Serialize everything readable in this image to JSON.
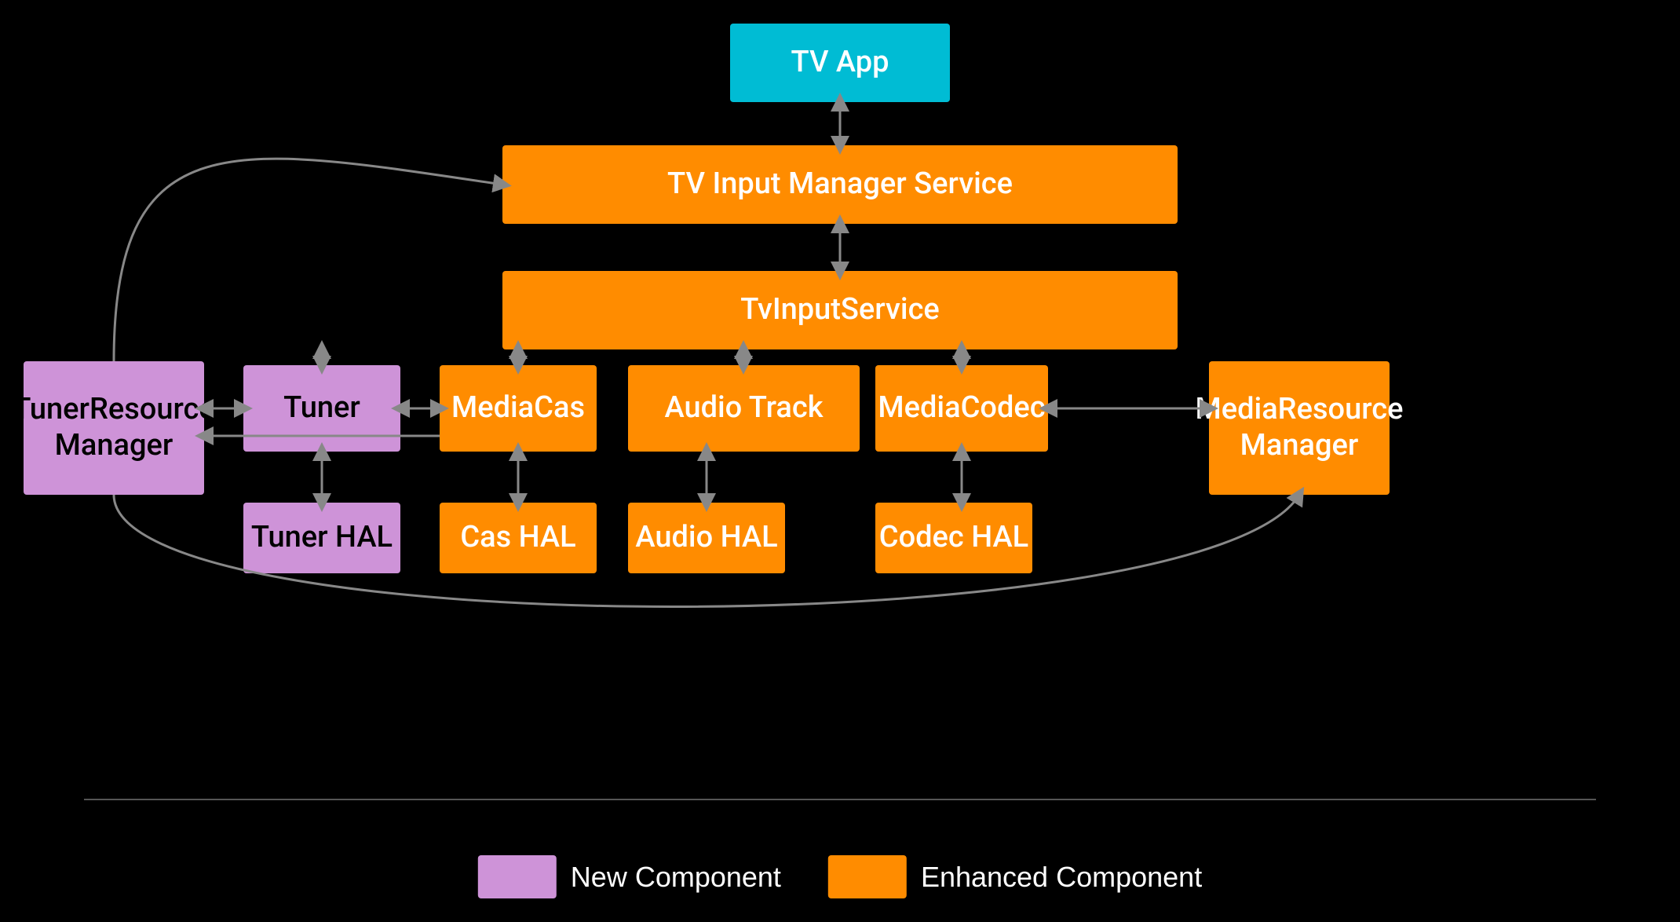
{
  "nodes": {
    "tv_app": "TV App",
    "tv_input_manager": "TV Input Manager Service",
    "tv_input_service": "TvInputService",
    "tuner_resource_manager": "TunerResource\nManager",
    "tuner": "Tuner",
    "media_cas": "MediaCas",
    "audio_track": "Audio Track",
    "media_codec": "MediaCodec",
    "media_resource_manager": "MediaResource\nManager",
    "tuner_hal": "Tuner HAL",
    "cas_hal": "Cas HAL",
    "audio_hal": "Audio HAL",
    "codec_hal": "Codec HAL"
  },
  "legend": {
    "new_component": "New Component",
    "enhanced_component": "Enhanced Component"
  },
  "colors": {
    "orange": "#FF8C00",
    "cyan": "#00BCD4",
    "purple": "#CE93D8",
    "arrow": "#888888",
    "background": "#000000"
  }
}
